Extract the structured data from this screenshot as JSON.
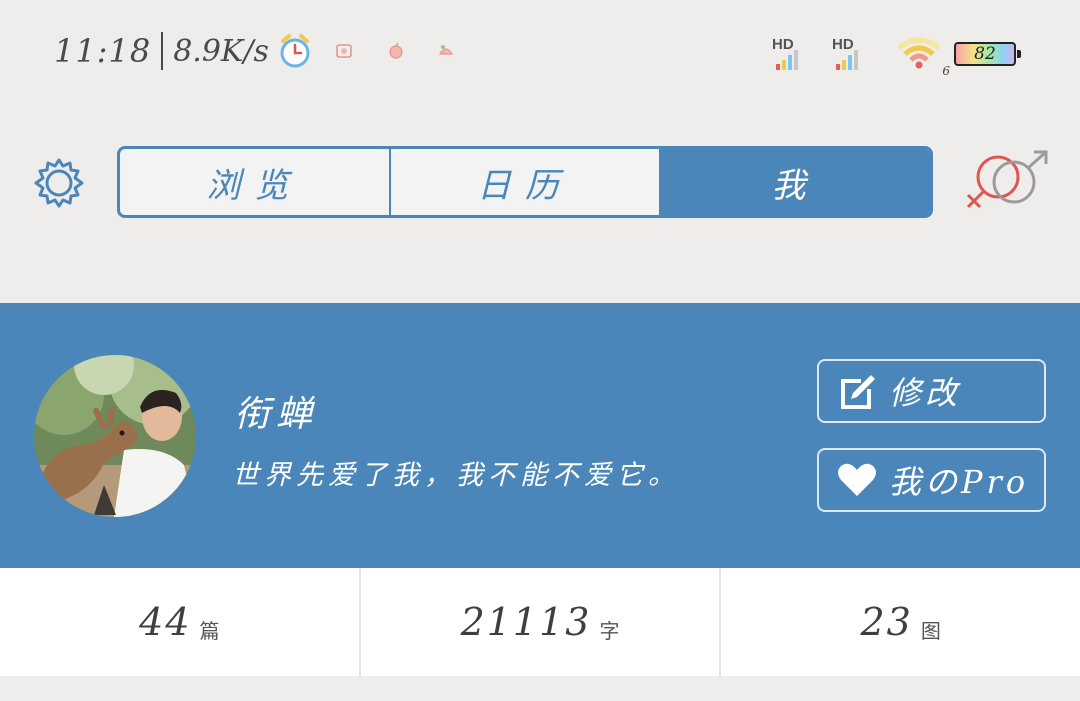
{
  "status_bar": {
    "time": "11:18",
    "net_speed": "8.9K/s",
    "signal1_label": "HD",
    "signal2_label": "HD",
    "wifi_badge": "6",
    "battery": "82"
  },
  "nav": {
    "tabs": [
      {
        "label": "浏览"
      },
      {
        "label": "日历"
      },
      {
        "label": "我"
      }
    ],
    "active_tab": 2
  },
  "profile": {
    "name": "衔蝉",
    "motto": "世界先爱了我，我不能不爱它。",
    "edit_label": "修改",
    "pro_label": "我のPro"
  },
  "stats": [
    {
      "value": "44",
      "unit": "篇"
    },
    {
      "value": "21113",
      "unit": "字"
    },
    {
      "value": "23",
      "unit": "图"
    }
  ],
  "colors": {
    "accent": "#4a86b9",
    "background": "#efedec",
    "female_symbol": "#e0554f",
    "male_symbol": "#9b9b9b"
  },
  "icons": {
    "settings": "gear-icon",
    "gender": "gender-symbols-icon",
    "edit": "pencil-square-icon",
    "pro": "heart-icon"
  }
}
